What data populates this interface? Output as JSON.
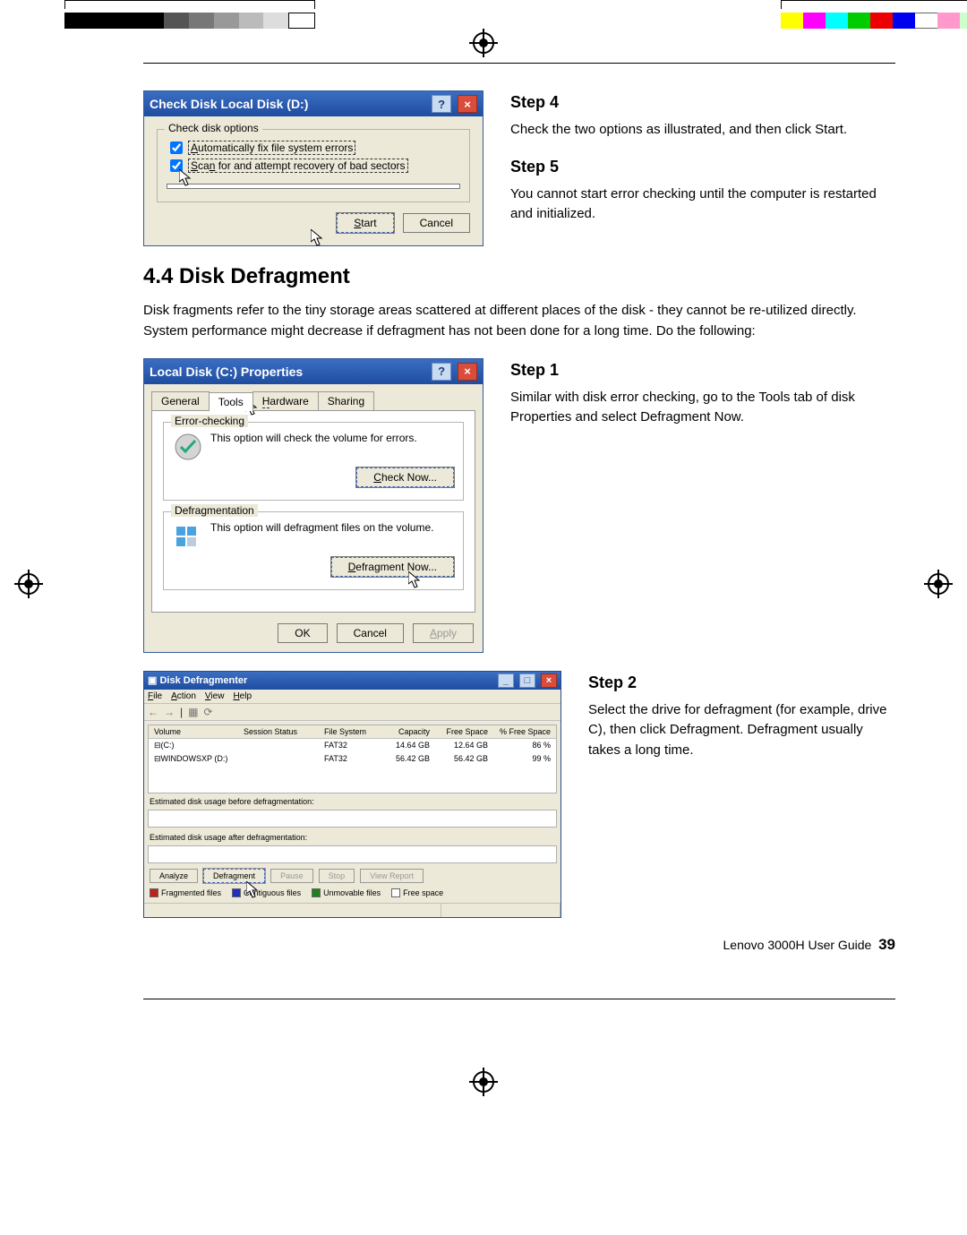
{
  "colorbar": [
    "#000",
    "#000",
    "#666",
    "#666",
    "#aaa",
    "#aaa",
    "#ddd",
    "#fff",
    "#ff0",
    "#f0f",
    "#0ff",
    "#0f0",
    "#f00",
    "#00f",
    "#fff",
    "#f99",
    "#cfc",
    "#fcf"
  ],
  "dlg1": {
    "title": "Check Disk Local Disk (D:)",
    "group": "Check disk options",
    "opt1": "Automatically fix file system errors",
    "opt2": "Scan for and attempt recovery of bad sectors",
    "start": "Start",
    "cancel": "Cancel"
  },
  "side1": {
    "s4h": "Step 4",
    "s4t": "Check the two options as illustrated, and then click Start.",
    "s5h": "Step 5",
    "s5t": "You cannot start error checking until the computer is restarted and initialized."
  },
  "section": {
    "heading": "4.4 Disk Defragment",
    "para": "Disk fragments refer to the tiny storage areas scattered at different places of the disk - they cannot be re-utilized directly. System performance might decrease if defragment has not been done for a long time. Do the following:"
  },
  "dlg2": {
    "title": "Local Disk (C:) Properties",
    "tabs": [
      "General",
      "Tools",
      "Hardware",
      "Sharing"
    ],
    "group1": "Error-checking",
    "g1txt": "This option will check the volume for errors.",
    "g1btn": "Check Now...",
    "group2": "Defragmentation",
    "g2txt": "This option will defragment files on the volume.",
    "g2btn": "Defragment Now...",
    "ok": "OK",
    "cancel": "Cancel",
    "apply": "Apply"
  },
  "side2": {
    "s1h": "Step 1",
    "s1t": "Similar with disk error checking, go to the Tools tab of disk Properties and select Defragment Now."
  },
  "win": {
    "title": "Disk Defragmenter",
    "menus": [
      "File",
      "Action",
      "View",
      "Help"
    ],
    "tb": [
      "←",
      "→",
      "▧",
      "⟳"
    ],
    "cols": [
      "Volume",
      "Session Status",
      "File System",
      "Capacity",
      "Free Space",
      "% Free Space"
    ],
    "rows": [
      {
        "vol": "(C:)",
        "status": "",
        "fs": "FAT32",
        "cap": "14.64 GB",
        "free": "12.64 GB",
        "pct": "86 %",
        "icon": "⊟"
      },
      {
        "vol": "WINDOWSXP (D:)",
        "status": "",
        "fs": "FAT32",
        "cap": "56.42 GB",
        "free": "56.42 GB",
        "pct": "99 %",
        "icon": "⊟"
      }
    ],
    "lbl1": "Estimated disk usage before defragmentation:",
    "lbl2": "Estimated disk usage after defragmentation:",
    "btns": [
      "Analyze",
      "Defragment",
      "Pause",
      "Stop",
      "View Report"
    ],
    "legend": [
      {
        "c": "#c02020",
        "t": "Fragmented files"
      },
      {
        "c": "#2030c0",
        "t": "Contiguous files"
      },
      {
        "c": "#208020",
        "t": "Unmovable files"
      },
      {
        "c": "#ffffff",
        "t": "Free space"
      }
    ]
  },
  "side3": {
    "s2h": "Step 2",
    "s2t": "Select the drive for defragment (for example, drive C), then click Defragment. Defragment usually takes a long time."
  },
  "footer": {
    "text": "Lenovo 3000H User Guide",
    "page": "39"
  }
}
